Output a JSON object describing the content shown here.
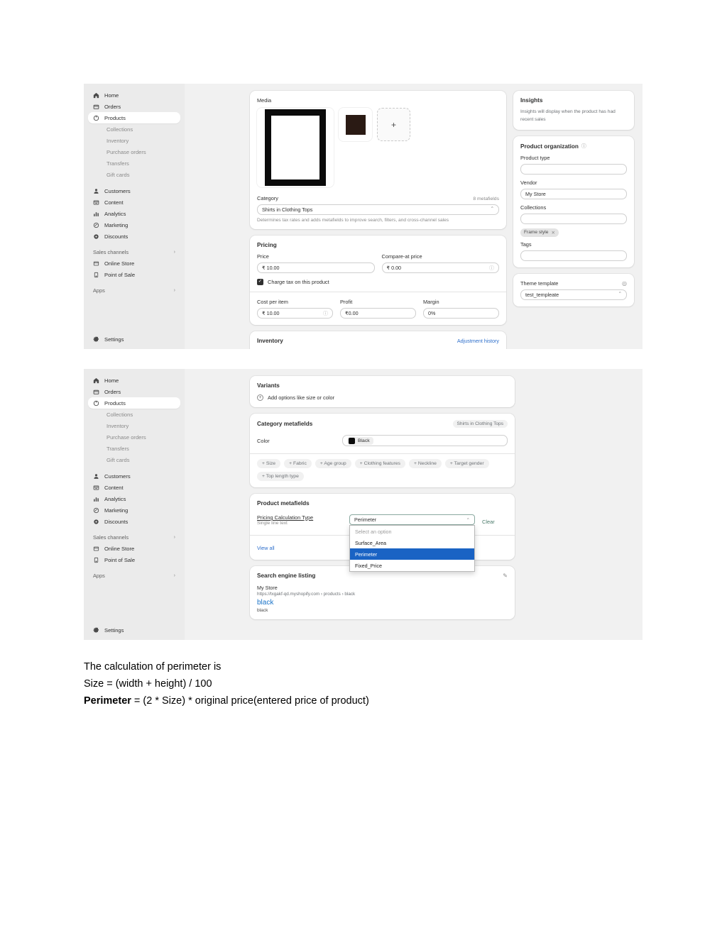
{
  "sidebar": {
    "items": [
      {
        "label": "Home",
        "icon": "home-icon",
        "type": "main"
      },
      {
        "label": "Orders",
        "icon": "orders-icon",
        "type": "main"
      },
      {
        "label": "Products",
        "icon": "products-icon",
        "type": "main",
        "active": true
      },
      {
        "label": "Collections",
        "icon": "",
        "type": "sub"
      },
      {
        "label": "Inventory",
        "icon": "",
        "type": "sub"
      },
      {
        "label": "Purchase orders",
        "icon": "",
        "type": "sub"
      },
      {
        "label": "Transfers",
        "icon": "",
        "type": "sub"
      },
      {
        "label": "Gift cards",
        "icon": "",
        "type": "sub"
      },
      {
        "label": "Customers",
        "icon": "customers-icon",
        "type": "main"
      },
      {
        "label": "Content",
        "icon": "content-icon",
        "type": "main"
      },
      {
        "label": "Analytics",
        "icon": "analytics-icon",
        "type": "main"
      },
      {
        "label": "Marketing",
        "icon": "marketing-icon",
        "type": "main"
      },
      {
        "label": "Discounts",
        "icon": "discounts-icon",
        "type": "main"
      }
    ],
    "sales_channels_label": "Sales channels",
    "channels": [
      {
        "label": "Online Store",
        "icon": "online-store-icon"
      },
      {
        "label": "Point of Sale",
        "icon": "point-of-sale-icon"
      }
    ],
    "apps_label": "Apps",
    "settings_label": "Settings"
  },
  "shot1": {
    "media": {
      "label": "Media",
      "add_label": "+"
    },
    "category": {
      "label": "Category",
      "metafields_badge": "8 metafields",
      "value": "Shirts in Clothing Tops",
      "helper": "Determines tax rates and adds metafields to improve search, filters, and cross-channel sales"
    },
    "pricing": {
      "title": "Pricing",
      "price_label": "Price",
      "price_value": "₹ 10.00",
      "compare_label": "Compare-at price",
      "compare_value": "₹ 0.00",
      "charge_tax_label": "Charge tax on this product",
      "cost_label": "Cost per item",
      "cost_value": "₹ 10.00",
      "profit_label": "Profit",
      "profit_value": "₹0.00",
      "margin_label": "Margin",
      "margin_value": "0%"
    },
    "inventory": {
      "title": "Inventory",
      "adjustment_link": "Adjustment history"
    },
    "rail": {
      "insights_title": "Insights",
      "insights_body": "Insights will display when the product has had recent sales",
      "org_title": "Product organization",
      "product_type_label": "Product type",
      "product_type_value": "",
      "vendor_label": "Vendor",
      "vendor_value": "My Store",
      "collections_label": "Collections",
      "collections_value": "",
      "collection_tag": "Frame style",
      "tags_label": "Tags",
      "tags_value": "",
      "theme_label": "Theme template",
      "theme_value": "test_templeate"
    }
  },
  "shot2": {
    "variants": {
      "title": "Variants",
      "add_options": "Add options like size or color"
    },
    "cat_metafields": {
      "title": "Category metafields",
      "badge": "Shirts in Clothing Tops",
      "color_label": "Color",
      "color_value": "Black",
      "chips": [
        "Size",
        "Fabric",
        "Age group",
        "Clothing features",
        "Neckline",
        "Target gender",
        "Top length type"
      ]
    },
    "product_metafields": {
      "title": "Product metafields",
      "field_label": "Pricing Calculation Type",
      "field_sub": "Single line text",
      "selected_value": "Perimeter",
      "clear_label": "Clear",
      "view_all_label": "View all",
      "options": [
        {
          "label": "Select an option",
          "state": "placeholder"
        },
        {
          "label": "Surface_Area",
          "state": "normal"
        },
        {
          "label": "Perimeter",
          "state": "selected"
        },
        {
          "label": "Fixed_Price",
          "state": "normal"
        }
      ]
    },
    "seo": {
      "title": "Search engine listing",
      "store": "My Store",
      "url": "https://txgakf-qd.myshopify.com › products › black",
      "page_title": "black",
      "description": "black"
    }
  },
  "caption": {
    "line1": "The calculation of perimeter is",
    "line2": "Size = (width + height) / 100",
    "line3_bold": "Perimeter",
    "line3_rest": " = (2 * Size) * original price(entered price of product)"
  },
  "colors": {
    "link_blue": "#2c6ecb",
    "clear_teal": "#4a7a6a",
    "dropdown_highlight": "#1a63c4",
    "seo_title_blue": "#1a73c8"
  }
}
